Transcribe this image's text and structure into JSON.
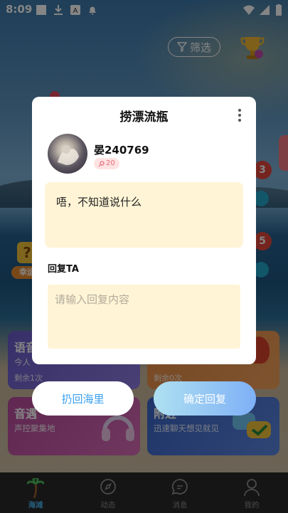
{
  "status": {
    "time": "8:09"
  },
  "header": {
    "filter_label": "筛选"
  },
  "side_badges": {
    "count_a": "3",
    "count_b": "5",
    "left_tag": "幸运"
  },
  "cards": [
    {
      "title": "语音",
      "subtitle": "今人",
      "remain": "剩余1次",
      "color_a": "#6a5bc9",
      "color_b": "#8d7be0"
    },
    {
      "title": "",
      "subtitle": "",
      "remain": "剩余0次",
      "color_a": "#e58a46",
      "color_b": "#f1a15a"
    },
    {
      "title": "音遇",
      "subtitle": "声控聚集地",
      "remain": "",
      "color_a": "#b64c9c",
      "color_b": "#d86bb6"
    },
    {
      "title": "附近",
      "subtitle": "迅速聊天想见就见",
      "remain": "",
      "color_a": "#3a64c8",
      "color_b": "#5b86e0"
    }
  ],
  "tabs": [
    {
      "label": "海滩",
      "icon": "palm-tree-icon",
      "active": true
    },
    {
      "label": "动态",
      "icon": "compass-icon"
    },
    {
      "label": "消息",
      "icon": "message-icon"
    },
    {
      "label": "我的",
      "icon": "person-icon"
    }
  ],
  "modal": {
    "title": "捞漂流瓶",
    "username": "晏240769",
    "badge_value": "20",
    "message": "唔，不知道说什么",
    "reply_label": "回复TA",
    "reply_placeholder": "请输入回复内容",
    "back_button": "扔回海里",
    "confirm_button": "确定回复"
  },
  "colors": {
    "accent": "#3aa0f0",
    "note_bg": "#fff4d6",
    "badge_bg": "#ffe2e2"
  }
}
